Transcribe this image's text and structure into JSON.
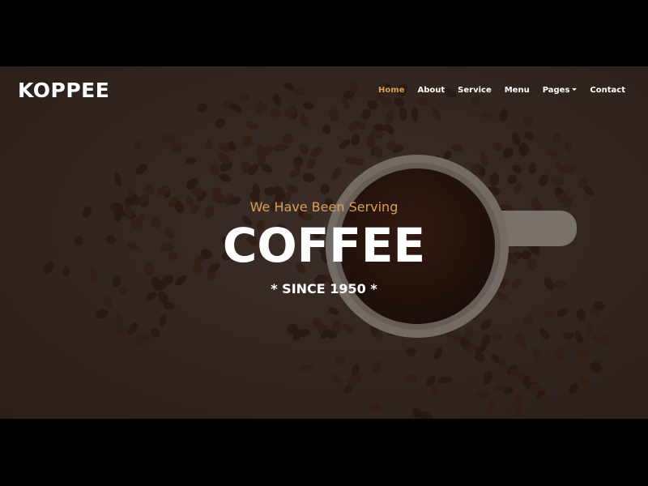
{
  "nav": {
    "brand": "KOPPEE",
    "items": [
      {
        "label": "Home",
        "active": true
      },
      {
        "label": "About"
      },
      {
        "label": "Service"
      },
      {
        "label": "Menu"
      },
      {
        "label": "Pages",
        "dropdown": true
      },
      {
        "label": "Contact"
      }
    ]
  },
  "hero": {
    "tagline": "We Have Been Serving",
    "headline": "COFFEE",
    "since": "* SINCE 1950 *"
  },
  "colors": {
    "accent": "#DA9F5B",
    "background": "#3a2d28",
    "text": "#ffffff"
  },
  "icons": {
    "dropdown": "caret-down-icon"
  }
}
